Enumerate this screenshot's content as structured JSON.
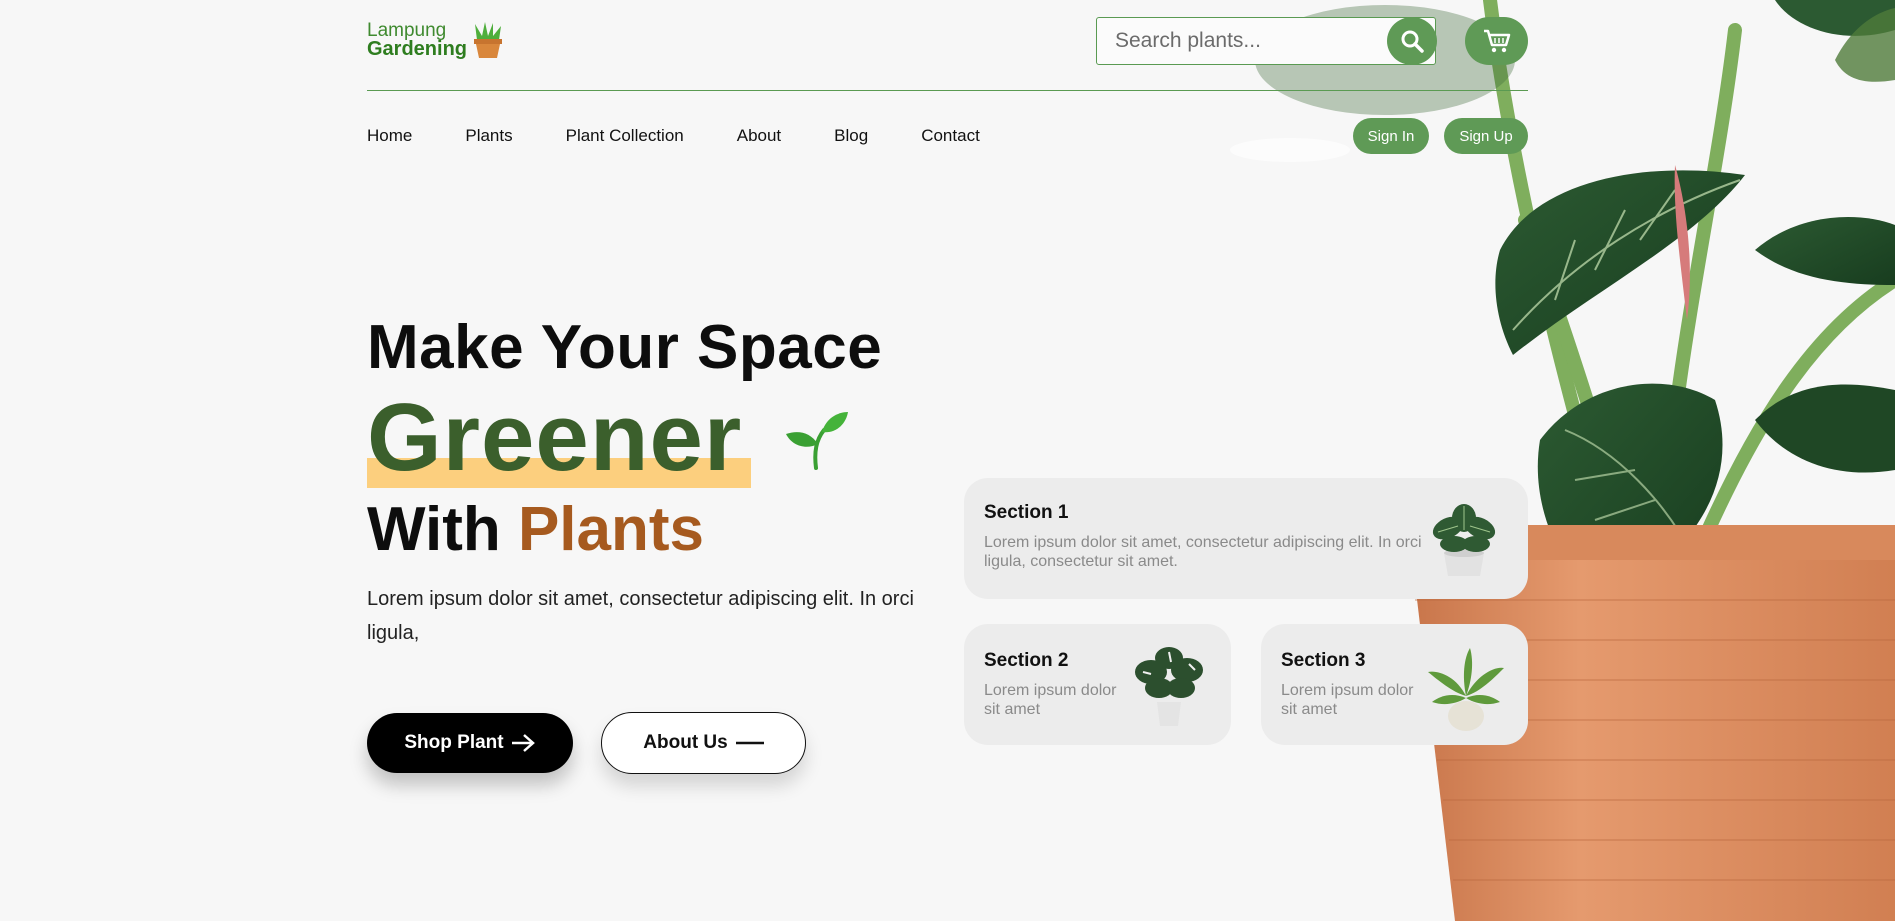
{
  "brand": {
    "line1": "Lampung",
    "line2": "Gardening"
  },
  "search": {
    "placeholder": "Search plants..."
  },
  "nav": [
    "Home",
    "Plants",
    "Plant Collection",
    "About",
    "Blog",
    "Contact"
  ],
  "auth": {
    "sign_in": "Sign In",
    "sign_up": "Sign Up"
  },
  "hero": {
    "line1": "Make Your Space",
    "line2": "Greener",
    "line3_prefix": "With",
    "line3_accent": "Plants",
    "description": "Lorem ipsum dolor sit amet, consectetur adipiscing elit. In orci ligula,",
    "shop_label": "Shop Plant",
    "about_label": "About Us"
  },
  "sections": [
    {
      "title": "Section 1",
      "desc": "Lorem ipsum dolor sit amet, consectetur adipiscing elit. In orci ligula, consectetur sit amet."
    },
    {
      "title": "Section 2",
      "desc": "Lorem ipsum dolor sit amet"
    },
    {
      "title": "Section 3",
      "desc": "Lorem ipsum dolor sit amet"
    }
  ],
  "colors": {
    "accent_green": "#5f9a56",
    "dark_green": "#3b5f2c",
    "highlight": "#fccf7e",
    "accent_brown": "#a65a1f"
  },
  "icons": {
    "search": "search-icon",
    "cart": "cart-icon",
    "logo": "potted-plant-icon",
    "sprout": "sprout-icon",
    "arrow": "arrow-right-icon",
    "dash": "dash-icon"
  }
}
